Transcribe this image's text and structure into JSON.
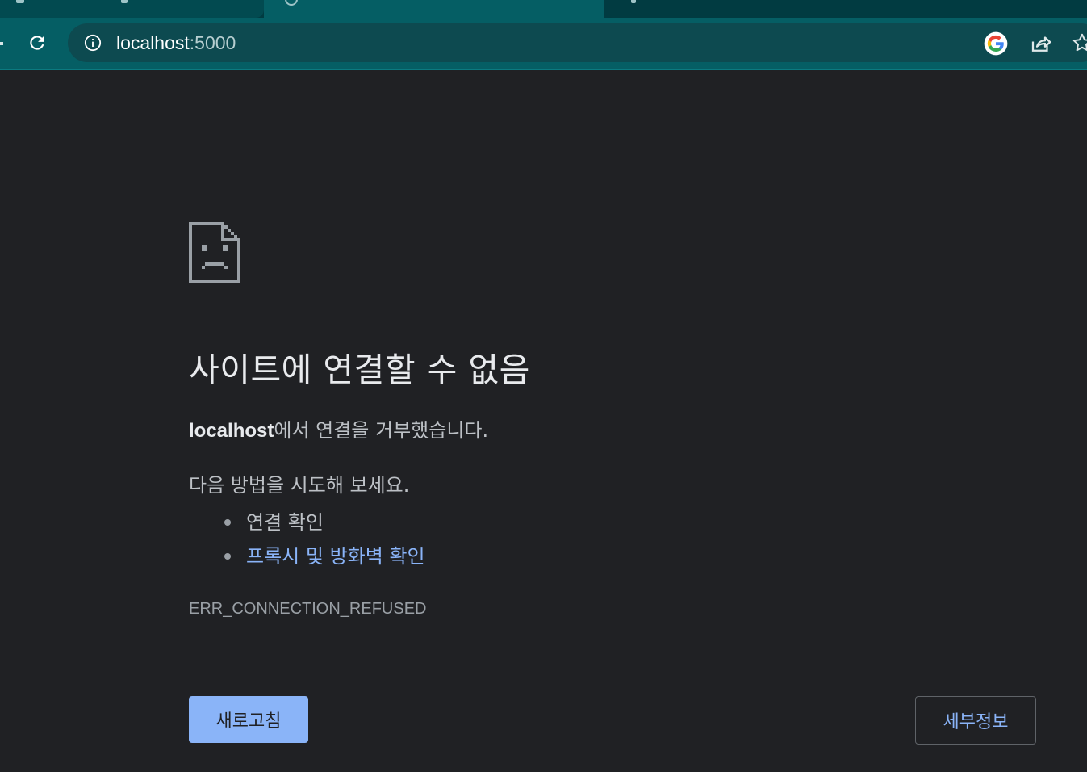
{
  "browser": {
    "address_bar": {
      "host": "localhost",
      "port": ":5000"
    },
    "icons": {
      "reload": "reload-icon",
      "site_info": "info-icon",
      "google_lens": "google-icon",
      "share": "share-icon",
      "bookmark": "star-icon"
    }
  },
  "error_page": {
    "heading": "사이트에 연결할 수 없음",
    "summary_host": "localhost",
    "summary_text": "에서 연결을 거부했습니다.",
    "suggestions_heading": "다음 방법을 시도해 보세요.",
    "suggestions": [
      "연결 확인",
      "프록시 및 방화벽 확인"
    ],
    "error_code": "ERR_CONNECTION_REFUSED",
    "reload_button_label": "새로고침",
    "details_button_label": "세부정보"
  },
  "colors": {
    "page_background": "#202124",
    "toolbar": "#055e64",
    "link": "#8ab4f8",
    "primary_button": "#8ab4f8"
  }
}
